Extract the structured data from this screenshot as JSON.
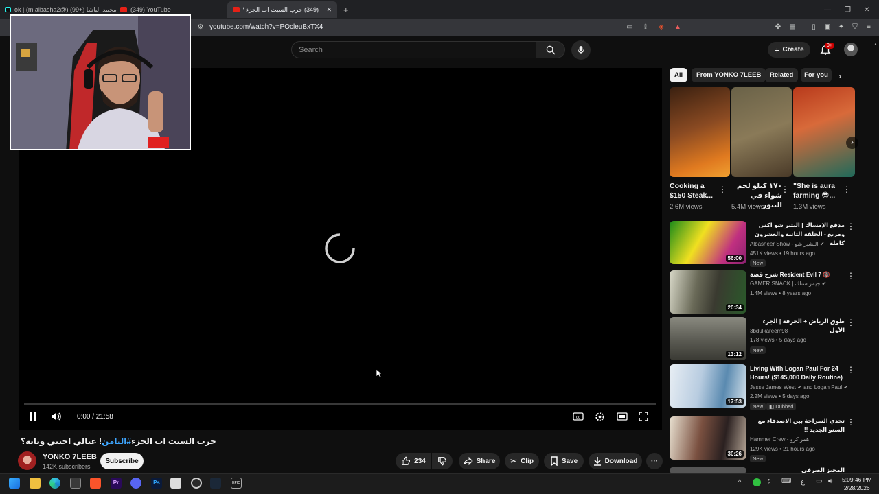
{
  "browser": {
    "tabs": [
      {
        "label": "محمد الباشا (m.albasha2@) (+99) | TikTok",
        "display": "ok | (m.albasha2@) محمد الباشا (+99)"
      },
      {
        "label": "(349) YouTube"
      },
      {
        "label": "(349) حرب السيت اب الجزء #الثامن"
      }
    ],
    "new_tab": "+",
    "url": "youtube.com/watch?v=POcleuBxTX4"
  },
  "header": {
    "search_placeholder": "Search",
    "create_label": "Create",
    "notifications_badge": "9+"
  },
  "player": {
    "time": "0:00 / 21:58",
    "progress": 0
  },
  "video": {
    "title_part1": "! عيالي اجنبي ويانة؟",
    "title_hashtag": "#الثامن",
    "title_part2": "حرب السيت اب الجزء",
    "channel_name": "YONKO 7LEEB",
    "subscribers": "142K subscribers",
    "subscribe_label": "Subscribe",
    "likes": "234",
    "share_label": "Share",
    "clip_label": "Clip",
    "save_label": "Save",
    "download_label": "Download"
  },
  "chips": [
    "All",
    "From YONKO 7LEEB",
    "Related",
    "For you"
  ],
  "shorts": [
    {
      "title": "Cooking a $150 Steak...",
      "views": "2.6M views",
      "thumb_color": "#6b3a20"
    },
    {
      "title": "١٧٠ كيلو لحم شواء في التنور ...",
      "views": "5.4M views",
      "thumb_color": "#5d5238"
    },
    {
      "title": "\"She is aura farming 😎...",
      "views": "1.3M views",
      "thumb_color": "#7a2a1c"
    }
  ],
  "videos": [
    {
      "title": "مدفع الإمساك | البثير شو اكس ومربع - الحلقة الثانية والعشرون كاملة",
      "channel": "Albasheer Show - البشير شو",
      "verified": true,
      "meta": "451K views • 19 hours ago",
      "badge": "New",
      "duration": "56:00",
      "thumb_color": "#1d4f1a"
    },
    {
      "title": "شرح قصة Resident Evil 7 🔞",
      "channel": "GAMER SNACK | جيمر سناك",
      "verified": true,
      "meta": "1.4M views • 8 years ago",
      "badge": "",
      "duration": "20:34",
      "thumb_color": "#3d3a30"
    },
    {
      "title": "طوق الرياض + الحرفة | الجزء الأول",
      "channel": "3bdulkareem98",
      "verified": false,
      "meta": "178 views • 5 days ago",
      "badge": "New",
      "duration": "13:12",
      "thumb_color": "#5a5850"
    },
    {
      "title": "Living With Logan Paul For 24 Hours! ($145,000 Daily Routine)",
      "channel": "Jesse James West",
      "channel2": "and Logan Paul",
      "verified": true,
      "meta": "2.2M views • 5 days ago",
      "badge": "New",
      "badge2": "Dubbed",
      "duration": "17:53",
      "thumb_color": "#6a8fb0"
    },
    {
      "title": "تحدي السراحة بين الاصدقاء مع السنو الجديد !!",
      "channel": "Hammer Crew - همر كرو",
      "verified": false,
      "meta": "129K views • 21 hours ago",
      "badge": "New",
      "duration": "30:26",
      "thumb_color": "#3a2a28"
    },
    {
      "title": "المخيز الصرفي",
      "channel": "",
      "verified": false,
      "meta": "",
      "badge": "",
      "duration": "",
      "thumb_color": "#444"
    }
  ],
  "taskbar": {
    "time": "5:09:46 PM",
    "date": "2/28/2026",
    "lang": "ع"
  },
  "colors": {
    "yt_bg": "#0f0f0f",
    "accent_red": "#ff0000",
    "link_blue": "#3ea6ff"
  }
}
